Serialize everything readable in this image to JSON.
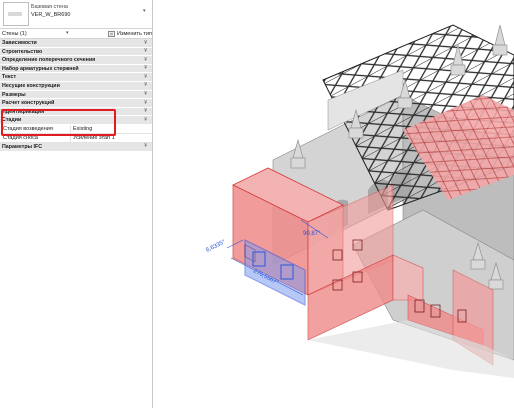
{
  "properties": {
    "type_selector": {
      "family": "Базовая стена",
      "type_name": "VER_W_BR690"
    },
    "filter": {
      "label": "Стены (1)",
      "edit_type_label": "Изменить тип"
    },
    "groups": [
      {
        "label": "Зависимости"
      },
      {
        "label": "Строительство"
      },
      {
        "label": "Определение поперечного сечения"
      },
      {
        "label": "Набор арматурных стержней"
      },
      {
        "label": "Текст"
      },
      {
        "label": "Несущие конструкции"
      },
      {
        "label": "Размеры"
      },
      {
        "label": "Расчет конструкций"
      },
      {
        "label": "Идентификация"
      },
      {
        "label": "Стадии"
      }
    ],
    "phase_rows": [
      {
        "key": "Стадия возведения",
        "value": "Existing"
      },
      {
        "key": "Стадия сноса",
        "value": "Усиление этап 1"
      }
    ],
    "last_group": {
      "label": "Параметры IFC"
    }
  },
  "viewport": {
    "dimensions": [
      {
        "value": "8,6335°"
      },
      {
        "value": "90,87°"
      },
      {
        "value": "276,5567°"
      }
    ],
    "colors": {
      "demolish_fill": "#f08a8a",
      "demolish_edge": "#d23b3b",
      "wall_gray": "#c9c9c9",
      "dim_blue": "#2f57d9"
    }
  }
}
